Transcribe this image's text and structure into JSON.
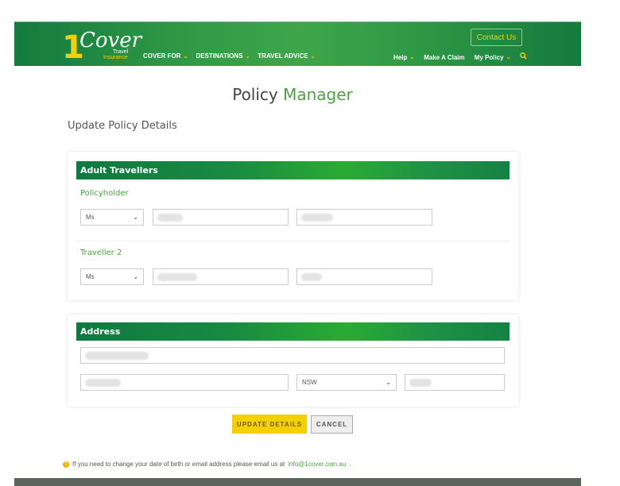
{
  "header": {
    "logo": {
      "numeral": "1",
      "word": "Cover",
      "line1": "Travel",
      "line2": "Insurance"
    },
    "main_nav": [
      {
        "label": "COVER FOR",
        "icon": "chevron-down-icon"
      },
      {
        "label": "DESTINATIONS",
        "icon": "chevron-down-icon"
      },
      {
        "label": "TRAVEL ADVICE",
        "icon": "chevron-down-icon"
      }
    ],
    "contact_label": "Contact Us",
    "sub_nav": [
      {
        "label": "Help",
        "icon": "chevron-down-icon"
      },
      {
        "label": "Make A Claim"
      },
      {
        "label": "My Policy",
        "icon": "chevron-down-icon"
      }
    ],
    "search_icon": "search-icon"
  },
  "page": {
    "title_part1": "Policy",
    "title_part2": "Manager",
    "subtitle": "Update Policy Details"
  },
  "adult_travellers": {
    "heading": "Adult Travellers",
    "travellers": [
      {
        "label": "Policyholder",
        "title_value": "Ms",
        "first_name": "",
        "last_name": ""
      },
      {
        "label": "Traveller 2",
        "title_value": "Ms",
        "first_name": "",
        "last_name": ""
      }
    ]
  },
  "address": {
    "heading": "Address",
    "street": "",
    "suburb": "",
    "state_value": "NSW",
    "postcode": ""
  },
  "actions": {
    "update_label": "UPDATE DETAILS",
    "cancel_label": "CANCEL"
  },
  "note": {
    "text": "If you need to change your date of birth or email address please email us at",
    "email": "info@1cover.com.au",
    "suffix": "."
  },
  "colors": {
    "brand_green": "#137a3e",
    "accent_green": "#4aa53e",
    "brand_yellow": "#f5d000"
  }
}
